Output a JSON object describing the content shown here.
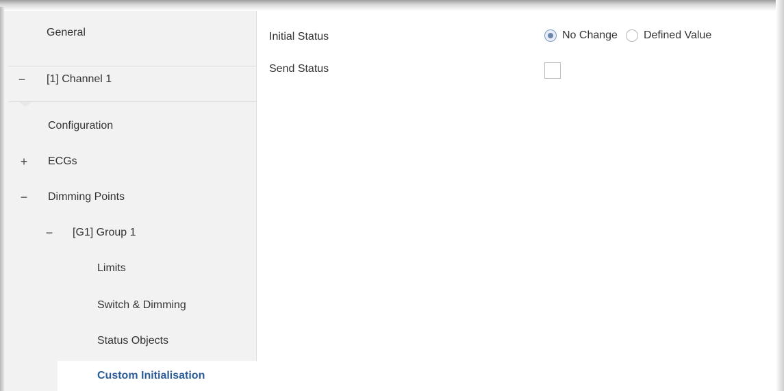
{
  "sidebar": {
    "items": [
      {
        "label": "General"
      },
      {
        "label": "[1] Channel 1",
        "expander": "−"
      },
      {
        "label": "Configuration"
      },
      {
        "label": "ECGs",
        "expander": "+"
      },
      {
        "label": "Dimming Points",
        "expander": "−"
      },
      {
        "label": "[G1] Group 1",
        "expander": "−"
      },
      {
        "label": "Limits"
      },
      {
        "label": "Switch & Dimming"
      },
      {
        "label": "Status Objects"
      },
      {
        "label": "Custom Initialisation",
        "active": true
      }
    ]
  },
  "main": {
    "initial_status": {
      "label": "Initial Status",
      "options": [
        "No Change",
        "Defined Value"
      ],
      "selected": "No Change"
    },
    "send_status": {
      "label": "Send Status",
      "checked": false
    }
  },
  "colors": {
    "active_text": "#2b5d9b",
    "sidebar_bg": "#f2f2f2",
    "radio_selected_dot": "#6d86ad"
  }
}
